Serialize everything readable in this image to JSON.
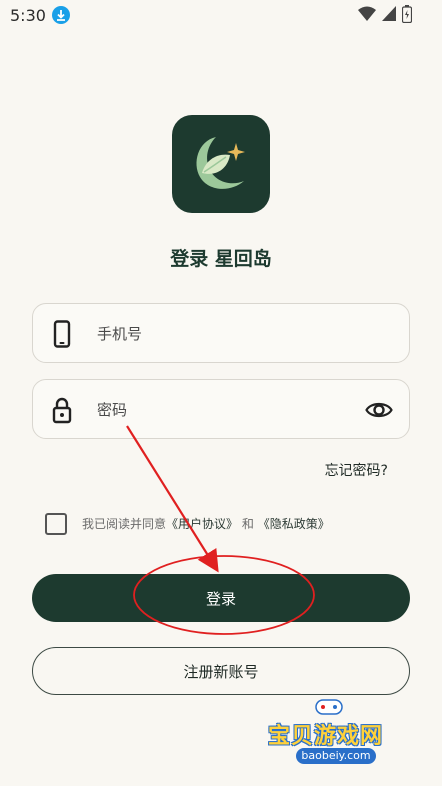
{
  "status_bar": {
    "time": "5:30"
  },
  "app": {
    "title": "登录 星回岛",
    "brand_color": "#1d3a2f",
    "accent_color": "#e7b95a"
  },
  "form": {
    "phone_placeholder": "手机号",
    "password_placeholder": "密码",
    "forgot_label": "忘记密码?",
    "agreement_prefix": "我已阅读并同意",
    "user_agreement_link": "《用户协议》",
    "agreement_and": "和",
    "privacy_link": "《隐私政策》",
    "agreement_checked": false
  },
  "buttons": {
    "login_label": "登录",
    "register_label": "注册新账号"
  },
  "icons": {
    "status": [
      "download-icon",
      "wifi-icon",
      "signal-icon",
      "battery-icon"
    ],
    "phone_field": "phone-icon",
    "password_field": "lock-icon",
    "visibility": "eye-icon",
    "logo": "leaf-moon-star-logo"
  },
  "watermark": {
    "text": "宝贝游戏网",
    "url": "baobeiy.com"
  },
  "annotation": {
    "color": "#e02020"
  }
}
